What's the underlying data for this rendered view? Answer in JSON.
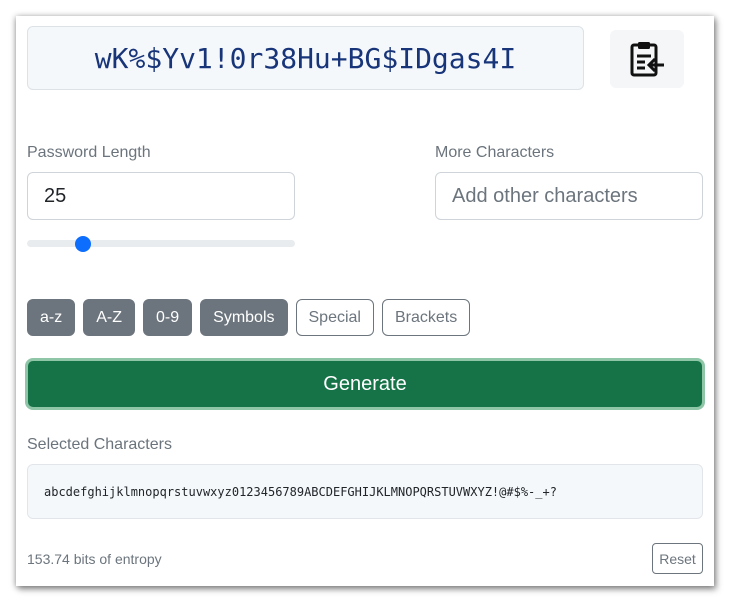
{
  "password": {
    "value": "wK%$Yv1!0r38Hu+BG$IDgas4I"
  },
  "copy_button": {
    "icon": "clipboard-paste-icon"
  },
  "length": {
    "label": "Password Length",
    "value": "25",
    "slider_fraction": 0.21
  },
  "more_chars": {
    "label": "More Characters",
    "placeholder": "Add other characters"
  },
  "charsets": [
    {
      "label": "a-z",
      "active": true
    },
    {
      "label": "A-Z",
      "active": true
    },
    {
      "label": "0-9",
      "active": true
    },
    {
      "label": "Symbols",
      "active": true
    },
    {
      "label": "Special",
      "active": false
    },
    {
      "label": "Brackets",
      "active": false
    }
  ],
  "generate": {
    "label": "Generate"
  },
  "selected": {
    "label": "Selected Characters",
    "value": "abcdefghijklmnopqrstuvwxyz0123456789ABCDEFGHIJKLMNOPQRSTUVWXYZ!@#$%-_+?"
  },
  "footer": {
    "entropy": "153.74 bits of entropy",
    "reset_label": "Reset"
  },
  "colors": {
    "primary": "#0d6efd",
    "success": "#157347",
    "secondary": "#6c757d",
    "password_text": "#18357a"
  }
}
